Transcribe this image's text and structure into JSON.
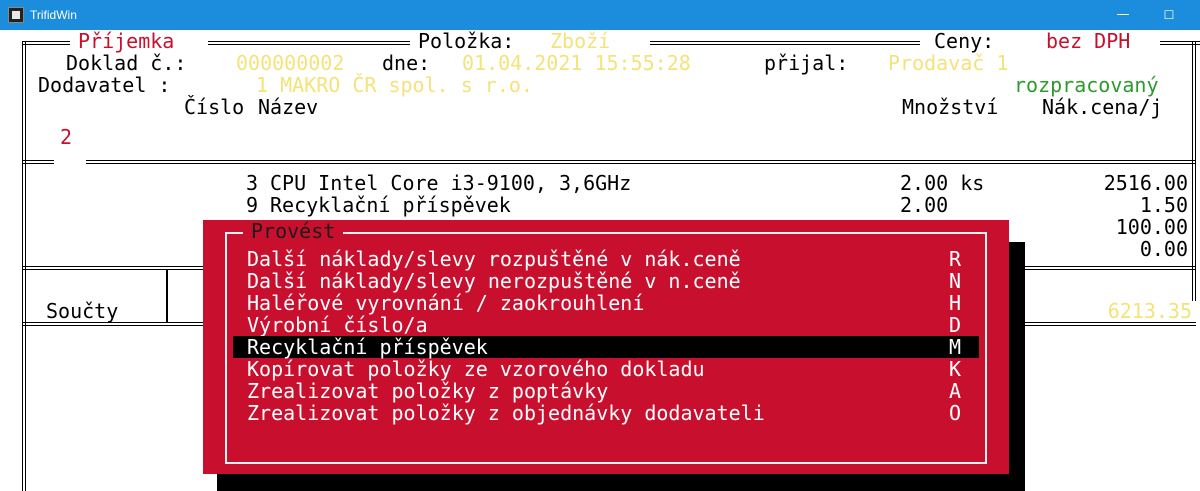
{
  "window": {
    "title": "TrifidWin",
    "minimize_glyph": "—",
    "maximize_glyph": "☐"
  },
  "header": {
    "section_title": "Příjemka",
    "item_label": "Položka:",
    "item_value": "Zboží",
    "prices_label": "Ceny:",
    "prices_value": "bez DPH",
    "doc_label": "Doklad č.:",
    "doc_number": "000000002",
    "date_label": "dne:",
    "date_value": "01.04.2021 15:55:28",
    "received_label": "přijal:",
    "received_value": "Prodavač 1",
    "supplier_label": "Dodavatel :",
    "supplier_value": "1 MAKRO ČR spol. s r.o.",
    "status": "rozpracovaný",
    "count": "2"
  },
  "table": {
    "headers": {
      "number": "Číslo",
      "name": "Název",
      "quantity": "Množství",
      "price": "Nák.cena/j"
    },
    "rows": [
      {
        "number": "3",
        "name": "CPU Intel Core i3-9100, 3,6GHz",
        "quantity": "2.00 ks",
        "price": "2516.00"
      },
      {
        "number": "9",
        "name": "Recyklační příspěvek",
        "quantity": "2.00",
        "price": "1.50"
      },
      {
        "price": "100.00"
      },
      {
        "price": "0.00"
      }
    ]
  },
  "totals": {
    "label": "Součty",
    "separator": ":",
    "value": "6213.35"
  },
  "menu": {
    "title": "Provést",
    "selected_index": 4,
    "items": [
      {
        "label": "Další náklady/slevy rozpuštěné v nák.ceně",
        "key": "R"
      },
      {
        "label": "Další náklady/slevy nerozpuštěné v n.ceně",
        "key": "N"
      },
      {
        "label": "Haléřové vyrovnání / zaokrouhlení",
        "key": "H"
      },
      {
        "label": "Výrobní číslo/a",
        "key": "D"
      },
      {
        "label": "Recyklační příspěvek",
        "key": "M"
      },
      {
        "label": "Kopírovat položky ze vzorového dokladu",
        "key": "K"
      },
      {
        "label": "Zrealizovat položky z poptávky",
        "key": "A"
      },
      {
        "label": "Zrealizovat položky z objednávky dodavateli",
        "key": "O"
      }
    ]
  },
  "colors": {
    "titlebar": "#1c8cdc",
    "menu_background": "#c8102e",
    "highlight_red": "#c8102e",
    "value_yellow": "#f4e27a",
    "status_green": "#2e9a2e"
  }
}
